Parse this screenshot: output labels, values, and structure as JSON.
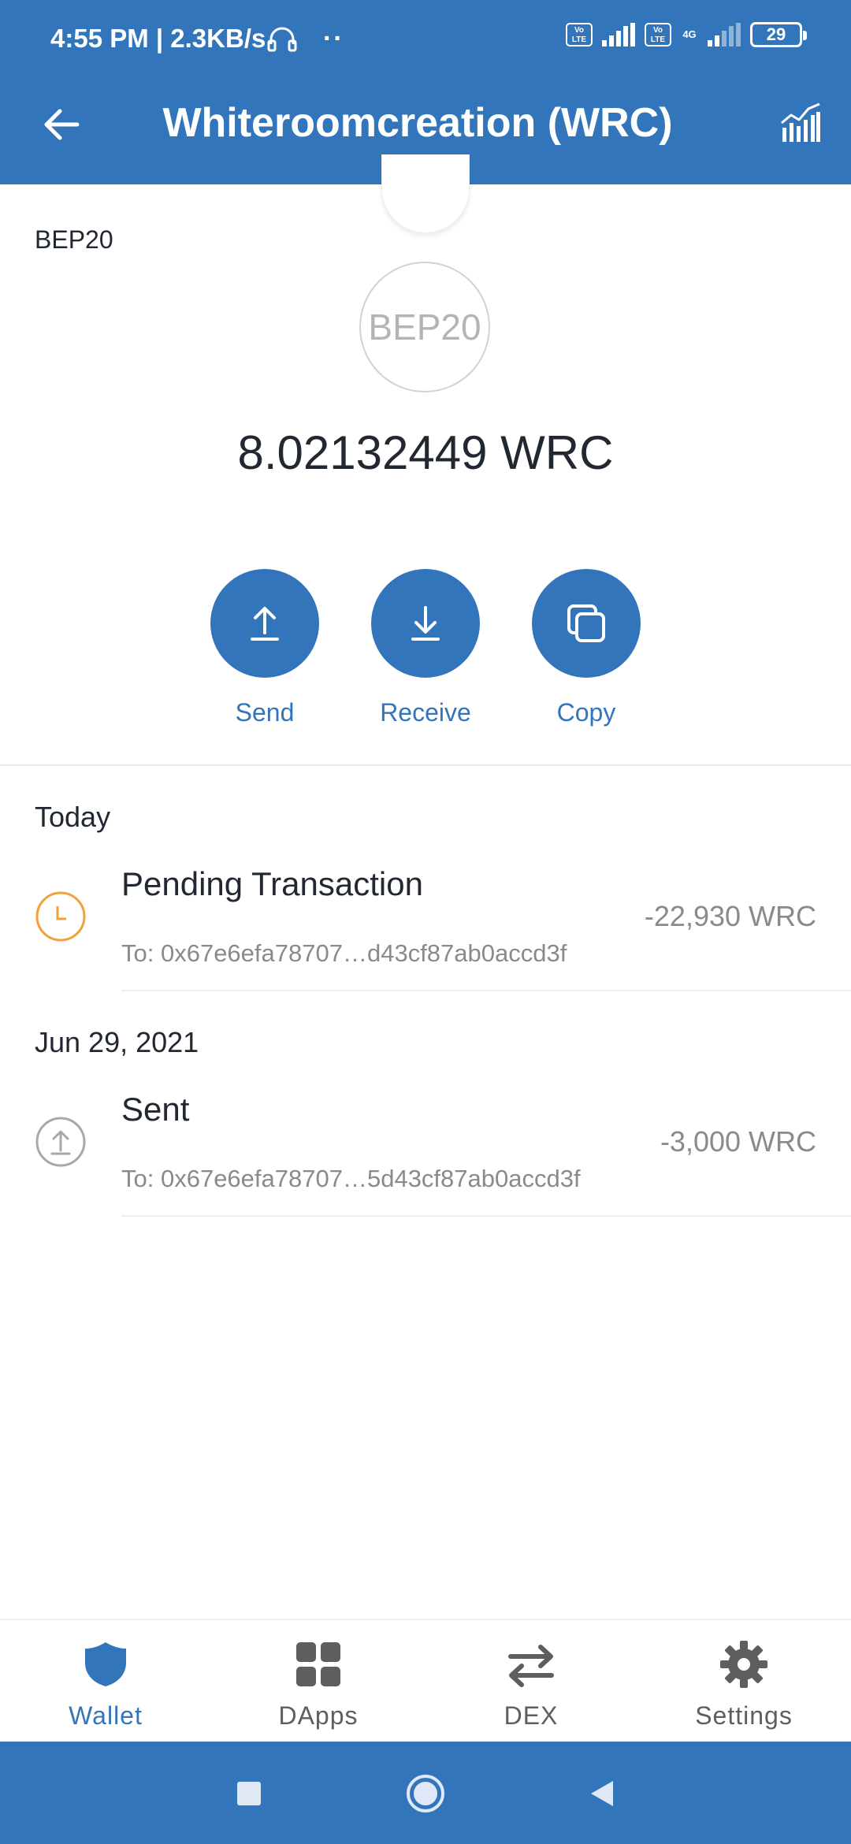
{
  "status_bar": {
    "time": "4:55 PM | 2.3KB/s",
    "dots": "··",
    "volte1": "Vo\nLTE",
    "volte2": "Vo\nLTE",
    "net_type": "4G",
    "battery": "29"
  },
  "header": {
    "title": "Whiteroomcreation (WRC)"
  },
  "token": {
    "network_label": "BEP20",
    "logo_text": "BEP20",
    "balance": "8.02132449 WRC"
  },
  "actions": [
    {
      "label": "Send"
    },
    {
      "label": "Receive"
    },
    {
      "label": "Copy"
    }
  ],
  "transactions": [
    {
      "date": "Today",
      "title": "Pending Transaction",
      "to": "To: 0x67e6efa78707…d43cf87ab0accd3f",
      "amount": "-22,930 WRC",
      "icon": "clock-icon"
    },
    {
      "date": "Jun 29, 2021",
      "title": "Sent",
      "to": "To: 0x67e6efa78707…5d43cf87ab0accd3f",
      "amount": "-3,000 WRC",
      "icon": "upload-icon"
    }
  ],
  "bottom_nav": [
    {
      "label": "Wallet",
      "icon": "shield-icon",
      "active": true
    },
    {
      "label": "DApps",
      "icon": "grid-icon",
      "active": false
    },
    {
      "label": "DEX",
      "icon": "swap-icon",
      "active": false
    },
    {
      "label": "Settings",
      "icon": "gear-icon",
      "active": false
    }
  ],
  "colors": {
    "brand": "#3375bb",
    "pending": "#f0a23a",
    "muted": "#8a8a8a"
  }
}
